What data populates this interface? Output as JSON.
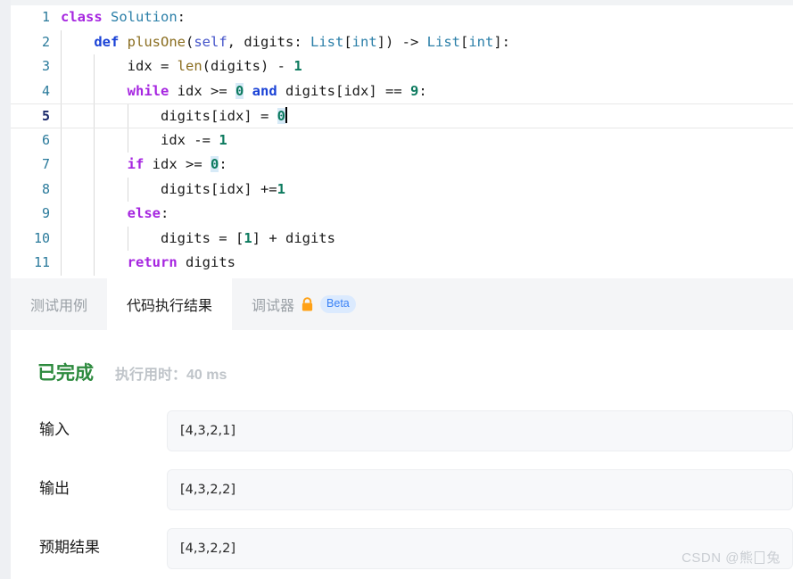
{
  "editor": {
    "language": "python",
    "active_line": 5,
    "lines": [
      {
        "num": "1",
        "indent_guides": 0,
        "tokens": [
          {
            "t": "class",
            "c": "kw"
          },
          {
            "t": " ",
            "c": "plain"
          },
          {
            "t": "Solution",
            "c": "cls"
          },
          {
            "t": ":",
            "c": "plain"
          }
        ]
      },
      {
        "num": "2",
        "indent_guides": 1,
        "tokens": [
          {
            "t": "    ",
            "c": "plain"
          },
          {
            "t": "def",
            "c": "kw2"
          },
          {
            "t": " ",
            "c": "plain"
          },
          {
            "t": "plusOne",
            "c": "fn"
          },
          {
            "t": "(",
            "c": "plain"
          },
          {
            "t": "self",
            "c": "self"
          },
          {
            "t": ", digits: ",
            "c": "plain"
          },
          {
            "t": "List",
            "c": "cls"
          },
          {
            "t": "[",
            "c": "plain"
          },
          {
            "t": "int",
            "c": "cls"
          },
          {
            "t": "]) -> ",
            "c": "plain"
          },
          {
            "t": "List",
            "c": "cls"
          },
          {
            "t": "[",
            "c": "plain"
          },
          {
            "t": "int",
            "c": "cls"
          },
          {
            "t": "]:",
            "c": "plain"
          }
        ]
      },
      {
        "num": "3",
        "indent_guides": 2,
        "tokens": [
          {
            "t": "        idx = ",
            "c": "plain"
          },
          {
            "t": "len",
            "c": "fn"
          },
          {
            "t": "(digits) - ",
            "c": "plain"
          },
          {
            "t": "1",
            "c": "num"
          }
        ]
      },
      {
        "num": "4",
        "indent_guides": 2,
        "tokens": [
          {
            "t": "        ",
            "c": "plain"
          },
          {
            "t": "while",
            "c": "kw"
          },
          {
            "t": " idx >= ",
            "c": "plain"
          },
          {
            "t": "0",
            "c": "numhl"
          },
          {
            "t": " ",
            "c": "plain"
          },
          {
            "t": "and",
            "c": "kw2"
          },
          {
            "t": " digits[idx] == ",
            "c": "plain"
          },
          {
            "t": "9",
            "c": "num"
          },
          {
            "t": ":",
            "c": "plain"
          }
        ]
      },
      {
        "num": "5",
        "indent_guides": 3,
        "tokens": [
          {
            "t": "            digits[idx] = ",
            "c": "plain"
          },
          {
            "t": "0",
            "c": "numhl"
          }
        ],
        "caret": true
      },
      {
        "num": "6",
        "indent_guides": 3,
        "tokens": [
          {
            "t": "            idx -= ",
            "c": "plain"
          },
          {
            "t": "1",
            "c": "num"
          }
        ]
      },
      {
        "num": "7",
        "indent_guides": 2,
        "tokens": [
          {
            "t": "        ",
            "c": "plain"
          },
          {
            "t": "if",
            "c": "kw"
          },
          {
            "t": " idx >= ",
            "c": "plain"
          },
          {
            "t": "0",
            "c": "numhl"
          },
          {
            "t": ":",
            "c": "plain"
          }
        ]
      },
      {
        "num": "8",
        "indent_guides": 3,
        "tokens": [
          {
            "t": "            digits[idx] +=",
            "c": "plain"
          },
          {
            "t": "1",
            "c": "num"
          }
        ]
      },
      {
        "num": "9",
        "indent_guides": 2,
        "tokens": [
          {
            "t": "        ",
            "c": "plain"
          },
          {
            "t": "else",
            "c": "kw"
          },
          {
            "t": ":",
            "c": "plain"
          }
        ]
      },
      {
        "num": "10",
        "indent_guides": 3,
        "tokens": [
          {
            "t": "            digits = [",
            "c": "plain"
          },
          {
            "t": "1",
            "c": "num"
          },
          {
            "t": "] + digits",
            "c": "plain"
          }
        ]
      },
      {
        "num": "11",
        "indent_guides": 2,
        "tokens": [
          {
            "t": "        ",
            "c": "plain"
          },
          {
            "t": "return",
            "c": "kw"
          },
          {
            "t": " digits",
            "c": "plain"
          }
        ]
      }
    ]
  },
  "tabs": [
    {
      "label": "测试用例",
      "active": false,
      "lock": false,
      "badge": null
    },
    {
      "label": "代码执行结果",
      "active": true,
      "lock": false,
      "badge": null
    },
    {
      "label": "调试器",
      "active": false,
      "lock": true,
      "badge": "Beta"
    }
  ],
  "result": {
    "status": "已完成",
    "runtime_label": "执行用时：",
    "runtime_value": "40 ms",
    "rows": [
      {
        "label": "输入",
        "value": "[4,3,2,1]"
      },
      {
        "label": "输出",
        "value": "[4,3,2,2]"
      },
      {
        "label": "预期结果",
        "value": "[4,3,2,2]"
      }
    ]
  },
  "watermark": {
    "prefix": "CSDN @熊",
    "suffix": "兔"
  },
  "colors": {
    "status_green": "#2d8a3e",
    "lock_orange": "#FFA116",
    "beta_blue": "#3b82f6",
    "beta_bg": "#dbeafe",
    "linenum": "#2a7a9b"
  }
}
